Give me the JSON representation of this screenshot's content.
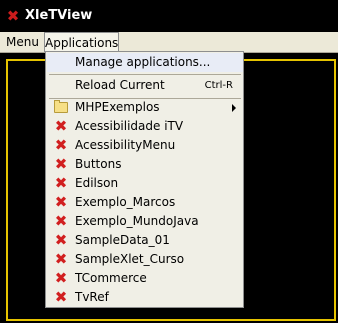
{
  "window": {
    "title": "XleTView",
    "icon": "x-icon"
  },
  "menubar": {
    "items": [
      "Menu",
      "Applications"
    ]
  },
  "dropdown": {
    "manage_label": "Manage applications...",
    "reload_label": "Reload Current",
    "reload_shortcut": "Ctrl-R",
    "folder_label": "MHPExemplos",
    "apps": [
      "Acessibilidade iTV",
      "AcessibilityMenu",
      "Buttons",
      "Edilson",
      "Exemplo_Marcos",
      "Exemplo_MundoJava",
      "SampleData_01",
      "SampleXlet_Curso",
      "TCommerce",
      "TvRef"
    ]
  },
  "colors": {
    "title_bg": "#000000",
    "accent_frame": "#e6c400",
    "x_icon": "#d11f1f",
    "menu_bg": "#f0efe6"
  }
}
